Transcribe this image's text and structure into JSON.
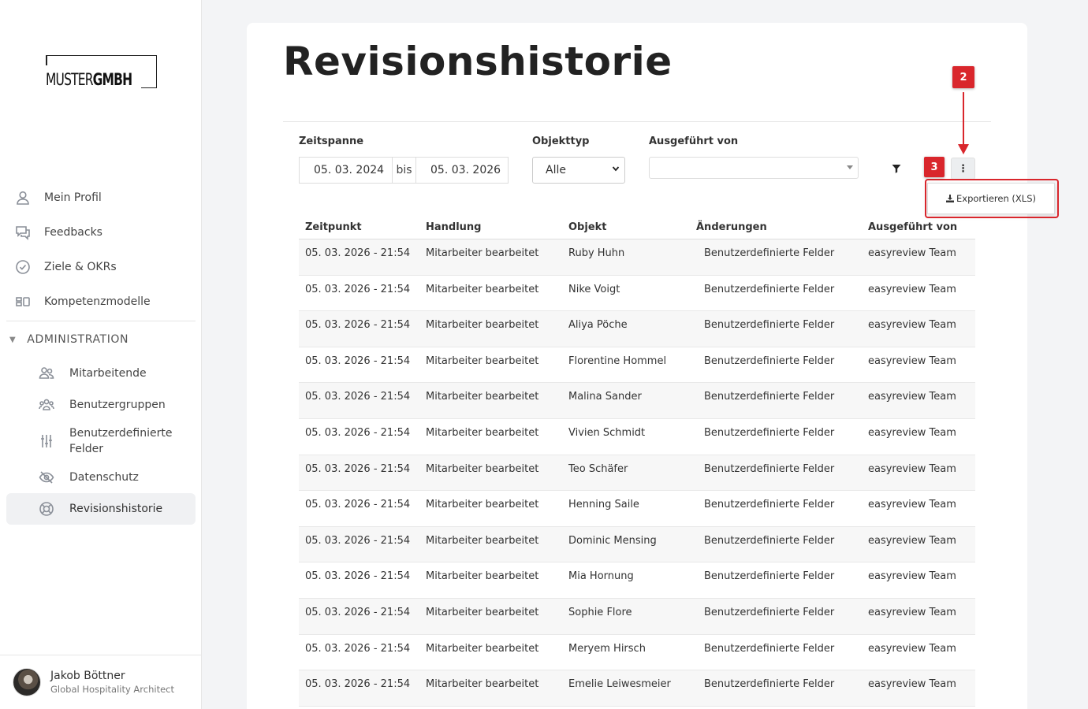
{
  "brand": {
    "logo_light": "MUSTER",
    "logo_bold": "GMBH"
  },
  "nav": {
    "items": [
      {
        "label": "Mein Profil",
        "icon": "user-icon"
      },
      {
        "label": "Feedbacks",
        "icon": "chat-bubbles-icon"
      },
      {
        "label": "Ziele & OKRs",
        "icon": "check-circle-icon"
      },
      {
        "label": "Kompetenzmodelle",
        "icon": "competency-icon"
      }
    ],
    "admin_heading": "ADMINISTRATION",
    "admin_items": [
      {
        "label": "Mitarbeitende",
        "icon": "users-icon"
      },
      {
        "label": "Benutzergruppen",
        "icon": "user-groups-icon"
      },
      {
        "label": "Benutzerdefinierte Felder",
        "icon": "sliders-icon"
      },
      {
        "label": "Datenschutz",
        "icon": "eye-off-icon"
      },
      {
        "label": "Revisionshistorie",
        "icon": "lifebuoy-icon",
        "active": true
      }
    ]
  },
  "user": {
    "name": "Jakob Böttner",
    "role": "Global Hospitality Architect"
  },
  "page": {
    "title": "Revisionshistorie"
  },
  "filters": {
    "timespan_label": "Zeitspanne",
    "date_from": "05. 03. 2024",
    "date_sep": "bis",
    "date_to": "05. 03. 2026",
    "objecttype_label": "Objekttyp",
    "objecttype_value": "Alle",
    "executed_by_label": "Ausgeführt von",
    "executed_by_value": ""
  },
  "menu": {
    "button_label": "⋮",
    "export_label": "Exportieren (XLS)"
  },
  "annotations": {
    "badge_2": "2",
    "badge_3": "3",
    "accent": "#d9262c"
  },
  "table": {
    "headers": [
      "Zeitpunkt",
      "Handlung",
      "Objekt",
      "Änderungen",
      "Ausgeführt von"
    ],
    "rows": [
      [
        "05. 03. 2026 - 21:54",
        "Mitarbeiter bearbeitet",
        "Ruby Huhn",
        "Benutzerdefinierte Felder",
        "easyreview Team"
      ],
      [
        "05. 03. 2026 - 21:54",
        "Mitarbeiter bearbeitet",
        "Nike Voigt",
        "Benutzerdefinierte Felder",
        "easyreview Team"
      ],
      [
        "05. 03. 2026 - 21:54",
        "Mitarbeiter bearbeitet",
        "Aliya Pöche",
        "Benutzerdefinierte Felder",
        "easyreview Team"
      ],
      [
        "05. 03. 2026 - 21:54",
        "Mitarbeiter bearbeitet",
        "Florentine Hommel",
        "Benutzerdefinierte Felder",
        "easyreview Team"
      ],
      [
        "05. 03. 2026 - 21:54",
        "Mitarbeiter bearbeitet",
        "Malina Sander",
        "Benutzerdefinierte Felder",
        "easyreview Team"
      ],
      [
        "05. 03. 2026 - 21:54",
        "Mitarbeiter bearbeitet",
        "Vivien Schmidt",
        "Benutzerdefinierte Felder",
        "easyreview Team"
      ],
      [
        "05. 03. 2026 - 21:54",
        "Mitarbeiter bearbeitet",
        "Teo Schäfer",
        "Benutzerdefinierte Felder",
        "easyreview Team"
      ],
      [
        "05. 03. 2026 - 21:54",
        "Mitarbeiter bearbeitet",
        "Henning Saile",
        "Benutzerdefinierte Felder",
        "easyreview Team"
      ],
      [
        "05. 03. 2026 - 21:54",
        "Mitarbeiter bearbeitet",
        "Dominic Mensing",
        "Benutzerdefinierte Felder",
        "easyreview Team"
      ],
      [
        "05. 03. 2026 - 21:54",
        "Mitarbeiter bearbeitet",
        "Mia Hornung",
        "Benutzerdefinierte Felder",
        "easyreview Team"
      ],
      [
        "05. 03. 2026 - 21:54",
        "Mitarbeiter bearbeitet",
        "Sophie Flore",
        "Benutzerdefinierte Felder",
        "easyreview Team"
      ],
      [
        "05. 03. 2026 - 21:54",
        "Mitarbeiter bearbeitet",
        "Meryem Hirsch",
        "Benutzerdefinierte Felder",
        "easyreview Team"
      ],
      [
        "05. 03. 2026 - 21:54",
        "Mitarbeiter bearbeitet",
        "Emelie Leiwesmeier",
        "Benutzerdefinierte Felder",
        "easyreview Team"
      ]
    ]
  }
}
